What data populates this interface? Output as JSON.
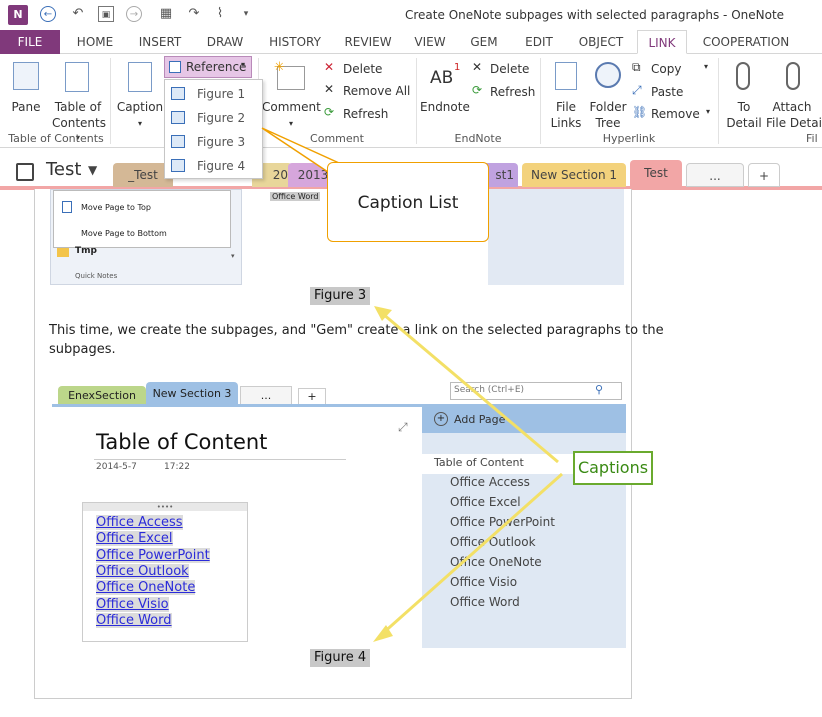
{
  "window": {
    "title": "Create OneNote subpages with selected paragraphs - OneNote"
  },
  "ribbon_tabs": [
    "FILE",
    "HOME",
    "INSERT",
    "DRAW",
    "HISTORY",
    "REVIEW",
    "VIEW",
    "GEM",
    "EDIT",
    "OBJECT",
    "LINK",
    "COOPERATION"
  ],
  "ribbon": {
    "pane": "Pane",
    "toc_line1": "Table of",
    "toc_line2": "Contents",
    "toc_group": "Table of Contents",
    "caption": "Caption",
    "reference": "Reference",
    "comment": "Comment",
    "delete": "Delete",
    "remove_all": "Remove All",
    "refresh": "Refresh",
    "comment_group": "Comment",
    "endnote": "Endnote",
    "endnote_icon": "AB",
    "endnote_sup": "1",
    "delete2": "Delete",
    "refresh2": "Refresh",
    "endnote_group": "EndNote",
    "file_line1": "File",
    "file_line2": "Links",
    "folder_line1": "Folder",
    "folder_line2": "Tree",
    "copy": "Copy",
    "paste": "Paste",
    "remove": "Remove",
    "hyperlink_group": "Hyperlink",
    "to_line1": "To",
    "to_line2": "Detail",
    "attach_line1": "Attach",
    "attach_line2": "File Detail",
    "file_group_partial": "Fil"
  },
  "reference_menu": [
    "Figure 1",
    "Figure 2",
    "Figure 3",
    "Figure 4"
  ],
  "notebook": {
    "name": "Test"
  },
  "section_tabs": [
    {
      "label": "_Test",
      "color": "#d4b896"
    },
    {
      "label": "20",
      "color": "#e8d69a"
    },
    {
      "label": "2013",
      "color": "#d6a6dc"
    },
    {
      "label": "st1",
      "color": "#c0a2e0"
    },
    {
      "label": "New Section 1",
      "color": "#f3d27c"
    },
    {
      "label": "Test",
      "color": "#f2a6a6"
    },
    {
      "label": "...",
      "color": "#f5f5f5"
    },
    {
      "label": "+",
      "color": "#ffffff"
    }
  ],
  "accent_colors": {
    "onenote": "#80397b",
    "callout_border": "#f0a000",
    "captions_border": "#6aaa2e",
    "arrow": "#f3e066"
  },
  "top_shot": {
    "move_top": "Move Page to Top",
    "move_bottom": "Move Page to Bottom",
    "tmp": "Tmp",
    "quick_notes": "Quick Notes",
    "office_word": "Office Word"
  },
  "callouts": {
    "caption_list": "Caption List",
    "captions": "Captions"
  },
  "captions": {
    "fig3": "Figure 3",
    "fig4": "Figure 4"
  },
  "body_text": {
    "line1": "This time, we create the subpages, and \"Gem\" create a link on the selected paragraphs to the",
    "line2": "subpages."
  },
  "inner_shot": {
    "tabs": [
      "EnexSection",
      "New Section 3",
      "...",
      "+"
    ],
    "search_placeholder": "Search (Ctrl+E)",
    "add_page": "Add Page",
    "page_title": "Table of Content",
    "date": "2014-5-7",
    "time": "17:22",
    "links": [
      "Office Access",
      "Office Excel",
      "Office PowerPoint",
      "Office Outlook",
      "Office OneNote",
      "Office Visio",
      "Office Word"
    ],
    "page_list_title": "Table of Content",
    "page_list": [
      "Office Access",
      "Office Excel",
      "Office PowerPoint",
      "Office Outlook",
      "Office OneNote",
      "Office Visio",
      "Office Word"
    ]
  }
}
